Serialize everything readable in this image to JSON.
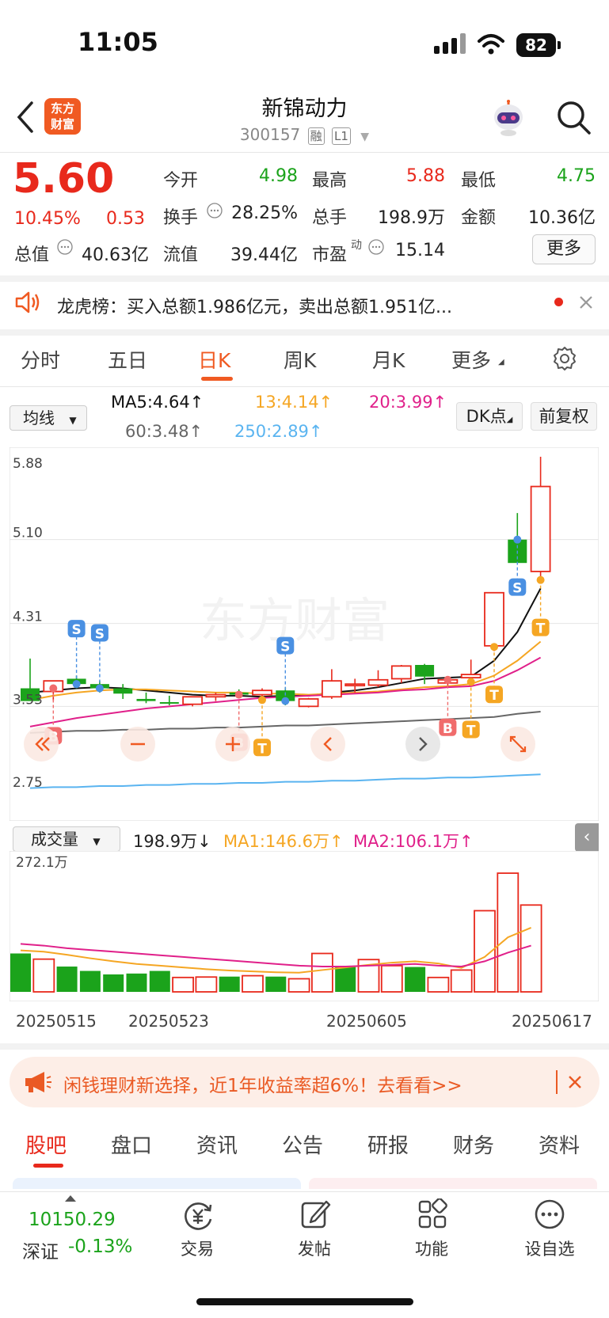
{
  "status": {
    "time": "11:05",
    "battery": "82"
  },
  "header": {
    "logo_line1": "东方",
    "logo_line2": "财富",
    "name": "新锦动力",
    "code": "300157",
    "tag1": "融",
    "tag2": "L1"
  },
  "quote": {
    "price": "5.60",
    "change_pct": "10.45%",
    "change": "0.53",
    "rows": [
      [
        {
          "l": "今开",
          "v": "4.98",
          "c": "green"
        },
        {
          "l": "最高",
          "v": "5.88",
          "c": "red"
        },
        {
          "l": "最低",
          "v": "4.75",
          "c": "green"
        }
      ],
      [
        {
          "l": "换手",
          "v": "28.25%",
          "c": "black"
        },
        {
          "l": "总手",
          "v": "198.9万",
          "c": "black"
        },
        {
          "l": "金额",
          "v": "10.36亿",
          "c": "black"
        }
      ],
      [
        {
          "l": "总值",
          "v": "40.63亿",
          "c": "black"
        },
        {
          "l": "流值",
          "v": "39.44亿",
          "c": "black"
        },
        {
          "l": "市盈",
          "v": "15.14",
          "c": "black"
        }
      ]
    ],
    "pe_superscript": "动",
    "more_label": "更多"
  },
  "dragon_banner": {
    "text": "龙虎榜：买入总额1.986亿元，卖出总额1.951亿..."
  },
  "tabs": [
    "分时",
    "五日",
    "日K",
    "周K",
    "月K",
    "更多"
  ],
  "active_tab": "日K",
  "ma": {
    "select_label": "均线",
    "ma5": "MA5:4.64↑",
    "ma13": "13:4.14↑",
    "ma20": "20:3.99↑",
    "ma60": "60:3.48↑",
    "ma250": "250:2.89↑",
    "dk_label": "DK点",
    "fq_label": "前复权",
    "colors": {
      "ma5": "#111111",
      "ma13": "#f5a623",
      "ma20": "#e0208a",
      "ma60": "#666666",
      "ma250": "#5ab4f0"
    }
  },
  "kchart": {
    "y_labels": [
      "5.88",
      "5.10",
      "4.31",
      "3.53",
      "2.75"
    ],
    "y_range": [
      2.75,
      5.88
    ],
    "candles": [
      {
        "o": 3.7,
        "h": 3.98,
        "l": 3.6,
        "c": 3.58
      },
      {
        "o": 3.67,
        "h": 3.75,
        "l": 3.58,
        "c": 3.77
      },
      {
        "o": 3.79,
        "h": 3.82,
        "l": 3.7,
        "c": 3.74
      },
      {
        "o": 3.74,
        "h": 3.77,
        "l": 3.66,
        "c": 3.7
      },
      {
        "o": 3.7,
        "h": 3.74,
        "l": 3.6,
        "c": 3.65
      },
      {
        "o": 3.6,
        "h": 3.66,
        "l": 3.56,
        "c": 3.58
      },
      {
        "o": 3.57,
        "h": 3.63,
        "l": 3.54,
        "c": 3.56
      },
      {
        "o": 3.55,
        "h": 3.62,
        "l": 3.53,
        "c": 3.62
      },
      {
        "o": 3.62,
        "h": 3.66,
        "l": 3.58,
        "c": 3.64
      },
      {
        "o": 3.66,
        "h": 3.69,
        "l": 3.62,
        "c": 3.64
      },
      {
        "o": 3.64,
        "h": 3.7,
        "l": 3.6,
        "c": 3.68
      },
      {
        "o": 3.68,
        "h": 3.71,
        "l": 3.54,
        "c": 3.58
      },
      {
        "o": 3.53,
        "h": 3.61,
        "l": 3.52,
        "c": 3.6
      },
      {
        "o": 3.62,
        "h": 3.88,
        "l": 3.6,
        "c": 3.77
      },
      {
        "o": 3.74,
        "h": 3.79,
        "l": 3.66,
        "c": 3.74
      },
      {
        "o": 3.73,
        "h": 3.87,
        "l": 3.71,
        "c": 3.78
      },
      {
        "o": 3.79,
        "h": 3.92,
        "l": 3.75,
        "c": 3.91
      },
      {
        "o": 3.92,
        "h": 3.93,
        "l": 3.74,
        "c": 3.81
      },
      {
        "o": 3.75,
        "h": 3.81,
        "l": 3.71,
        "c": 3.78
      },
      {
        "o": 3.8,
        "h": 3.97,
        "l": 3.77,
        "c": 3.83
      },
      {
        "o": 4.1,
        "h": 4.55,
        "l": 4.05,
        "c": 4.6
      },
      {
        "o": 5.1,
        "h": 5.35,
        "l": 4.9,
        "c": 4.88
      },
      {
        "o": 4.8,
        "h": 5.88,
        "l": 4.75,
        "c": 5.6
      }
    ],
    "ma_series": {
      "ma5": [
        3.66,
        3.68,
        3.7,
        3.71,
        3.7,
        3.68,
        3.66,
        3.64,
        3.63,
        3.63,
        3.62,
        3.63,
        3.63,
        3.66,
        3.68,
        3.71,
        3.75,
        3.79,
        3.8,
        3.81,
        3.96,
        4.23,
        4.64
      ],
      "ma13": [
        3.59,
        3.63,
        3.66,
        3.68,
        3.69,
        3.69,
        3.68,
        3.67,
        3.66,
        3.66,
        3.65,
        3.65,
        3.64,
        3.65,
        3.66,
        3.67,
        3.69,
        3.71,
        3.72,
        3.74,
        3.82,
        3.96,
        4.14
      ],
      "ma20": [
        3.34,
        3.38,
        3.42,
        3.45,
        3.48,
        3.51,
        3.53,
        3.55,
        3.57,
        3.59,
        3.61,
        3.62,
        3.63,
        3.64,
        3.65,
        3.66,
        3.68,
        3.69,
        3.71,
        3.72,
        3.77,
        3.87,
        3.99
      ],
      "ma60": [
        3.28,
        3.29,
        3.3,
        3.3,
        3.31,
        3.31,
        3.32,
        3.32,
        3.33,
        3.33,
        3.34,
        3.35,
        3.35,
        3.36,
        3.37,
        3.38,
        3.39,
        3.4,
        3.41,
        3.42,
        3.43,
        3.46,
        3.48
      ],
      "ma250": [
        2.76,
        2.77,
        2.77,
        2.78,
        2.78,
        2.79,
        2.79,
        2.8,
        2.8,
        2.81,
        2.81,
        2.82,
        2.82,
        2.83,
        2.83,
        2.84,
        2.85,
        2.85,
        2.86,
        2.86,
        2.87,
        2.88,
        2.89
      ]
    },
    "markers": [
      {
        "i": 1,
        "t": "B",
        "c": "#f06c6c",
        "v": 3.7,
        "pos": "below"
      },
      {
        "i": 2,
        "t": "S",
        "c": "#4a90e2",
        "v": 3.74,
        "pos": "above"
      },
      {
        "i": 3,
        "t": "S",
        "c": "#4a90e2",
        "v": 3.7,
        "pos": "above"
      },
      {
        "i": 9,
        "t": "B",
        "c": "#f06c6c",
        "v": 3.64,
        "pos": "below"
      },
      {
        "i": 10,
        "t": "T",
        "c": "#f5a623",
        "v": 3.59,
        "pos": "below"
      },
      {
        "i": 11,
        "t": "S",
        "c": "#4a90e2",
        "v": 3.58,
        "pos": "above"
      },
      {
        "i": 18,
        "t": "B",
        "c": "#f06c6c",
        "v": 3.78,
        "pos": "below"
      },
      {
        "i": 19,
        "t": "T",
        "c": "#f5a623",
        "v": 3.76,
        "pos": "below"
      },
      {
        "i": 20,
        "t": "T",
        "c": "#f5a623",
        "v": 4.09,
        "pos": "below"
      },
      {
        "i": 21,
        "t": "S",
        "c": "#4a90e2",
        "v": 5.1,
        "pos": "below"
      },
      {
        "i": 22,
        "t": "T",
        "c": "#f5a623",
        "v": 4.72,
        "pos": "below"
      }
    ]
  },
  "volume": {
    "select_label": "成交量",
    "value": "198.9万↓",
    "ma1": "MA1:146.6万↑",
    "ma2": "MA2:106.1万↑",
    "y_max_label": "272.1万",
    "y_max": 272.1,
    "bars": [
      {
        "v": 88,
        "up": false
      },
      {
        "v": 75,
        "up": true
      },
      {
        "v": 58,
        "up": false
      },
      {
        "v": 48,
        "up": false
      },
      {
        "v": 40,
        "up": false
      },
      {
        "v": 42,
        "up": false
      },
      {
        "v": 48,
        "up": false
      },
      {
        "v": 33,
        "up": true
      },
      {
        "v": 34,
        "up": true
      },
      {
        "v": 35,
        "up": false
      },
      {
        "v": 37,
        "up": true
      },
      {
        "v": 35,
        "up": false
      },
      {
        "v": 30,
        "up": true
      },
      {
        "v": 88,
        "up": true
      },
      {
        "v": 57,
        "up": false
      },
      {
        "v": 74,
        "up": true
      },
      {
        "v": 60,
        "up": true
      },
      {
        "v": 57,
        "up": false
      },
      {
        "v": 33,
        "up": true
      },
      {
        "v": 50,
        "up": true
      },
      {
        "v": 186,
        "up": true
      },
      {
        "v": 272,
        "up": true
      },
      {
        "v": 199,
        "up": true
      }
    ],
    "ma1_series": [
      95,
      92,
      85,
      77,
      70,
      64,
      60,
      56,
      52,
      49,
      47,
      45,
      44,
      50,
      56,
      62,
      67,
      70,
      65,
      55,
      80,
      125,
      147
    ],
    "ma2_series": [
      110,
      106,
      100,
      96,
      92,
      88,
      84,
      80,
      76,
      72,
      68,
      64,
      60,
      58,
      58,
      60,
      62,
      64,
      60,
      58,
      70,
      90,
      106
    ],
    "x_labels": [
      "20250515",
      "20250523",
      "20250605",
      "20250617"
    ]
  },
  "ad": {
    "text": "闲钱理财新选择，近1年收益率超6%！去看看>>"
  },
  "bottom_tabs": [
    "股吧",
    "盘口",
    "资讯",
    "公告",
    "研报",
    "财务",
    "资料"
  ],
  "index": {
    "value": "10150.29",
    "name": "深证",
    "change": "-0.13%"
  },
  "nav": [
    "交易",
    "发帖",
    "功能",
    "设自选"
  ]
}
